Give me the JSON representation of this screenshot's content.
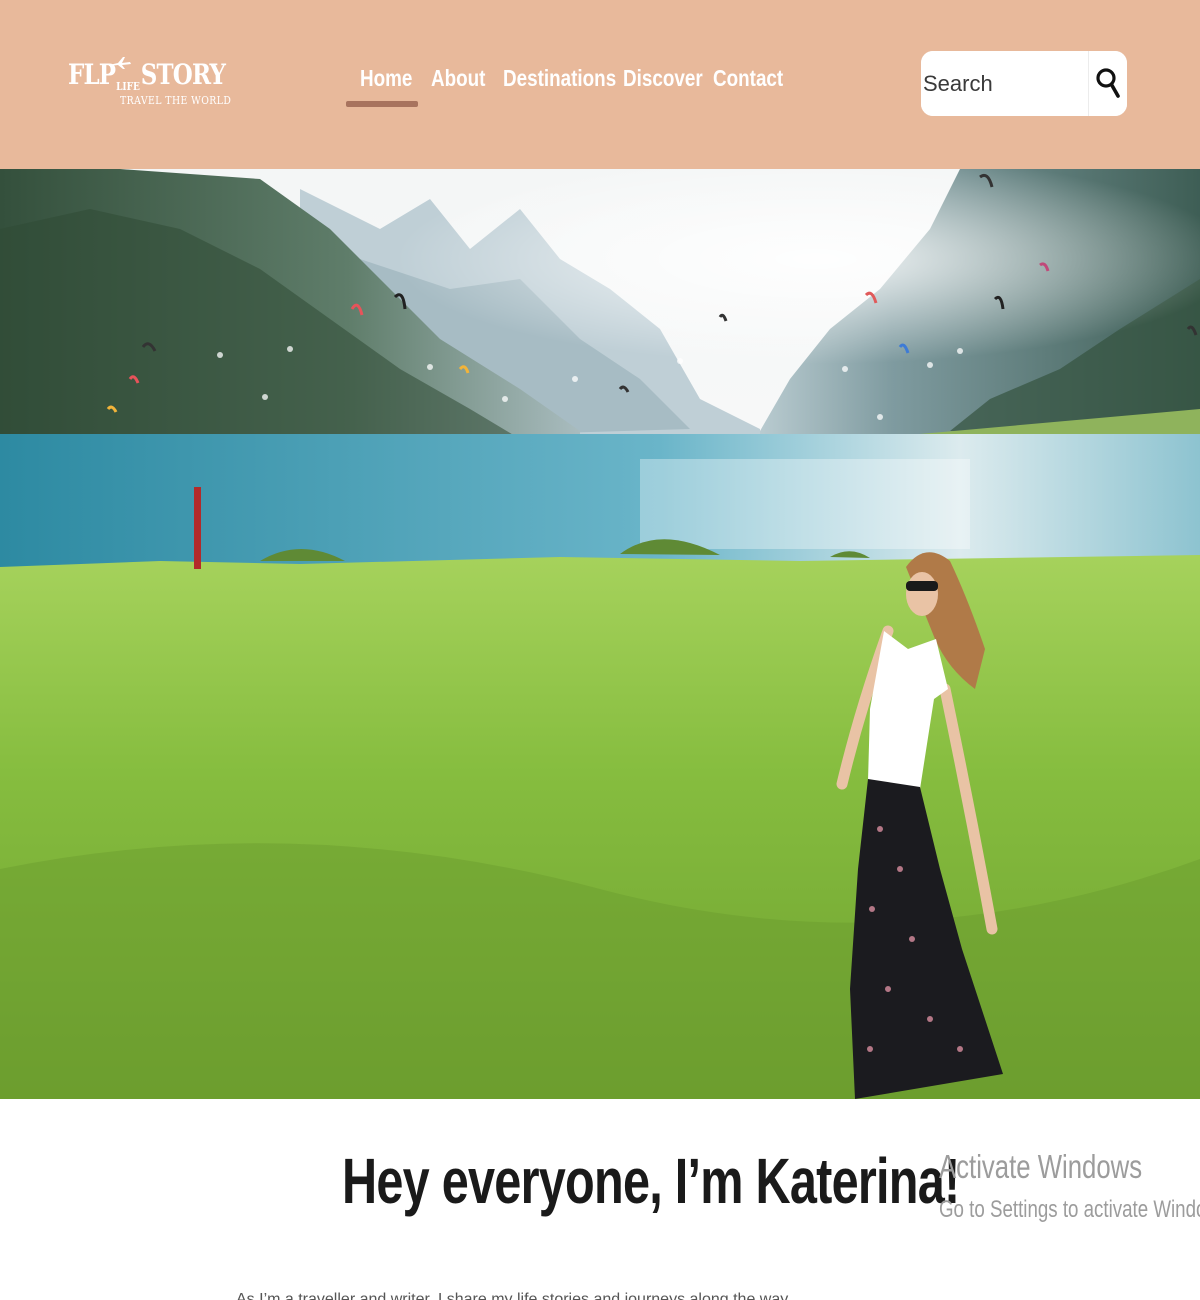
{
  "header": {
    "logo": {
      "word1": "FLP",
      "word2": "LIFE",
      "word3": "STORY",
      "tagline": "TRAVEL THE WORLD"
    },
    "nav": {
      "items": [
        {
          "label": "Home",
          "active": true
        },
        {
          "label": "About",
          "active": false
        },
        {
          "label": "Destinations",
          "active": false
        },
        {
          "label": "Discover",
          "active": false
        },
        {
          "label": "Contact",
          "active": false
        }
      ]
    },
    "search": {
      "placeholder": "Search",
      "value": "",
      "button_icon": "search-icon"
    }
  },
  "hero": {
    "image_alt": "Woman in white t-shirt and floral skirt dancing on a green meadow beside a mountain lake with kitesurfers"
  },
  "intro": {
    "heading": "Hey everyone, I’m Katerina!",
    "paragraph": "As I’m a traveller and writer, I share my life stories and journeys along the way..."
  },
  "overlay": {
    "activation_title": "Activate Windows",
    "activation_subtitle": "Go to Settings to activate Windows."
  },
  "colors": {
    "header_bg": "#e8b99b",
    "nav_text": "#ffffff",
    "nav_active_underline": "#a8735e",
    "heading_text": "#1a1a1a",
    "watermark_text": "#9c9c9c"
  }
}
